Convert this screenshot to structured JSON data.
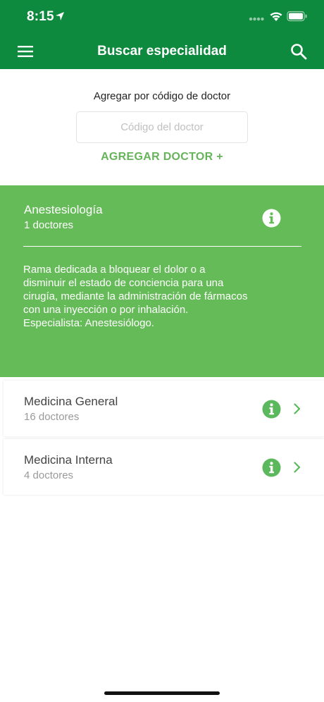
{
  "status_bar": {
    "time": "8:15"
  },
  "header": {
    "title": "Buscar especialidad"
  },
  "add_by_code": {
    "label": "Agregar por código de doctor",
    "input_value": "",
    "input_placeholder": "Código del doctor",
    "add_button_label": "AGREGAR DOCTOR +"
  },
  "specialties": [
    {
      "name": "Anestesiología",
      "count": "1 doctores",
      "expanded": true,
      "description": "Rama dedicada a bloquear el dolor o a\ndisminuir el estado de conciencia para una\ncirugía, mediante la administración de fármacos\ncon una inyección o por inhalación.\nEspecialista: Anestesiólogo."
    },
    {
      "name": "Medicina General",
      "count": "16 doctores",
      "expanded": false
    },
    {
      "name": "Medicina Interna",
      "count": "4 doctores",
      "expanded": false
    }
  ],
  "icons": {
    "menu": "hamburger-menu-icon",
    "search": "search-icon",
    "info": "info-icon",
    "chevron": "chevron-right-icon"
  },
  "colors": {
    "header_bg": "#0e8a3e",
    "accent_green": "#66bb59",
    "add_button": "#66b45a",
    "info_icon": "#5cb85c"
  }
}
